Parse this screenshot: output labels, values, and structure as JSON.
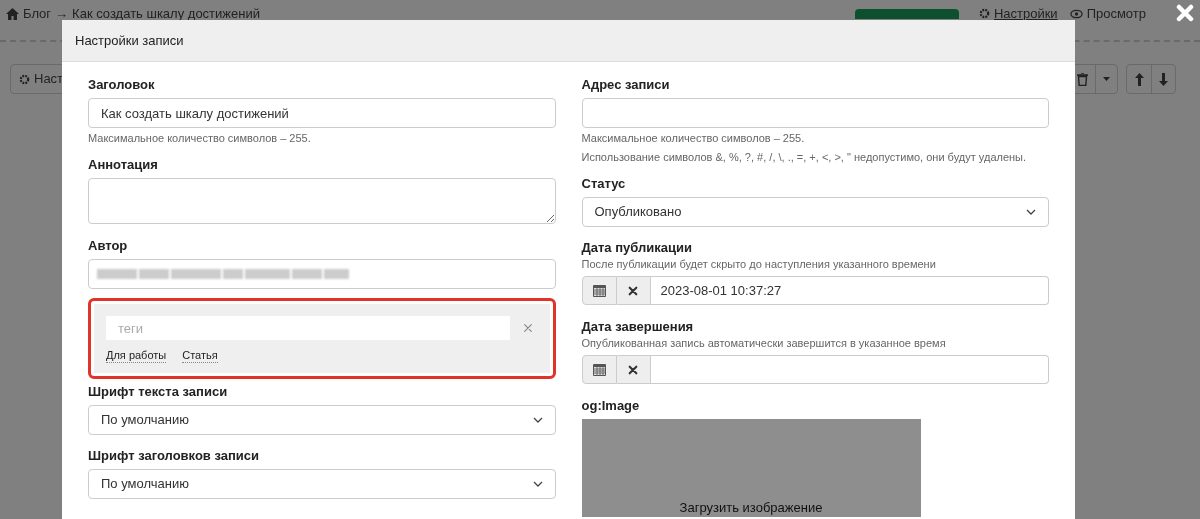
{
  "page": {
    "breadcrumb": [
      "Блог",
      "Как создать шкалу достижений"
    ],
    "separator": "→",
    "links": [
      "Настройки",
      "Просмотр"
    ],
    "toolbar_button": "Наст"
  },
  "dialog": {
    "title": "Настройки записи",
    "left": [
      {
        "kind": "text",
        "label": "Заголовок",
        "value": "Как создать шкалу достижений",
        "hints": [
          "Максимальное количество символов – 255."
        ]
      },
      {
        "kind": "textarea",
        "label": "Аннотация"
      },
      {
        "kind": "redacted",
        "label": "Автор"
      },
      {
        "kind": "tags",
        "placeholder": "теги",
        "tags": [
          "Для работы",
          "Статья"
        ],
        "highlighted": true
      },
      {
        "kind": "select",
        "label": "Шрифт текста записи",
        "value": "По умолчанию"
      },
      {
        "kind": "select",
        "label": "Шрифт заголовков записи",
        "value": "По умолчанию"
      }
    ],
    "right": [
      {
        "kind": "text",
        "label": "Адрес записи",
        "hints": [
          "Максимальное количество символов – 255.",
          "Использование символов &, %, ?, #, /, \\, ., =, +, <, >, \" недопустимо, они будут удалены."
        ]
      },
      {
        "kind": "select",
        "label": "Статус",
        "value": "Опубликовано"
      },
      {
        "kind": "date",
        "label": "Дата публикации",
        "hint": "После публикации будет скрыто до наступления указанного времени",
        "value": "2023-08-01 10:37:27"
      },
      {
        "kind": "date",
        "label": "Дата завершения",
        "hint": "Опубликованная запись автоматически завершится в указанное время"
      },
      {
        "kind": "image",
        "label": "og:Image",
        "button": "Загрузить изображение"
      }
    ]
  }
}
